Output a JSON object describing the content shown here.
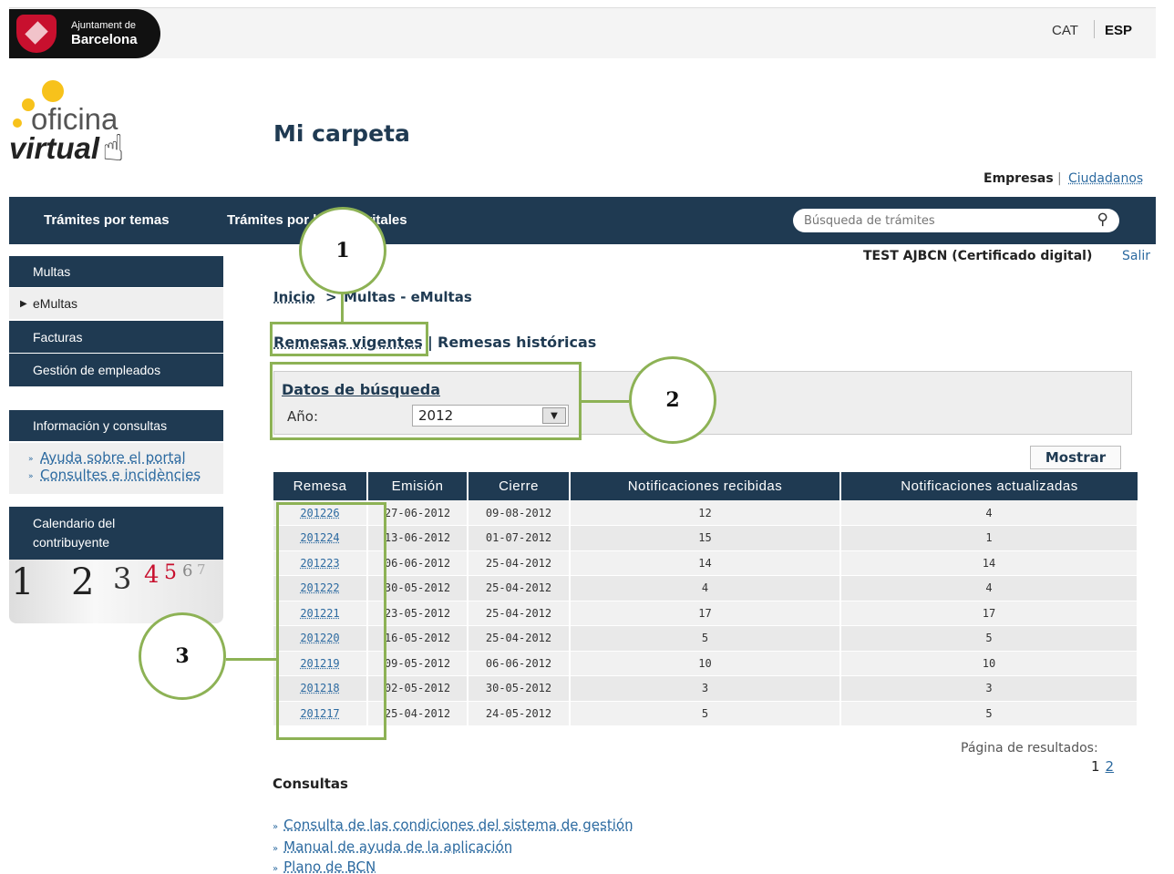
{
  "header": {
    "logo_line1": "Ajuntament de",
    "logo_line2": "Barcelona",
    "lang_cat": "CAT",
    "lang_esp": "ESP"
  },
  "brand": {
    "line1": "oficina",
    "line2": "virtual",
    "dot_color": "#f7c21b"
  },
  "page_title": "Mi carpeta",
  "audience": {
    "empresas": "Empresas",
    "sep": "|",
    "ciudadanos": "Ciudadanos"
  },
  "nav": {
    "items": [
      "Trámites por temas",
      "Trámites por hechos vitales"
    ],
    "search_placeholder": "Búsqueda de trámites",
    "search_icon": "magnifier-icon"
  },
  "user": {
    "name": "TEST AJBCN (Certificado digital)",
    "logout": "Salir"
  },
  "sidebar": {
    "items": [
      "Multas",
      "eMultas",
      "Facturas",
      "Gestión de empleados"
    ],
    "info_title": "Información y consultas",
    "info_links": [
      "Ayuda sobre el portal",
      "Consultes e incidències"
    ],
    "calendar_title_1": "Calendario del",
    "calendar_title_2": "contribuyente",
    "calendar_digits": [
      "1",
      "2",
      "3",
      "4",
      "5",
      "6",
      "7"
    ]
  },
  "breadcrumb": {
    "home": "Inicio",
    "sep": ">",
    "current": "Multas - eMultas"
  },
  "tabs": {
    "vigentes": "Remesas vigentes",
    "sep": "|",
    "historicas": "Remesas históricas"
  },
  "filter": {
    "title": "Datos de búsqueda",
    "year_label": "Año:",
    "year_value": "2012"
  },
  "show_button": "Mostrar",
  "table": {
    "headers": [
      "Remesa",
      "Emisión",
      "Cierre",
      "Notificaciones recibidas",
      "Notificaciones actualizadas"
    ],
    "rows": [
      [
        "201226",
        "27-06-2012",
        "09-08-2012",
        "12",
        "4"
      ],
      [
        "201224",
        "13-06-2012",
        "01-07-2012",
        "15",
        "1"
      ],
      [
        "201223",
        "06-06-2012",
        "25-04-2012",
        "14",
        "14"
      ],
      [
        "201222",
        "30-05-2012",
        "25-04-2012",
        "4",
        "4"
      ],
      [
        "201221",
        "23-05-2012",
        "25-04-2012",
        "17",
        "17"
      ],
      [
        "201220",
        "16-05-2012",
        "25-04-2012",
        "5",
        "5"
      ],
      [
        "201219",
        "09-05-2012",
        "06-06-2012",
        "10",
        "10"
      ],
      [
        "201218",
        "02-05-2012",
        "30-05-2012",
        "3",
        "3"
      ],
      [
        "201217",
        "25-04-2012",
        "24-05-2012",
        "5",
        "5"
      ]
    ]
  },
  "pagination": {
    "label": "Página de resultados:",
    "page1": "1",
    "page2": "2"
  },
  "consultas": {
    "title": "Consultas",
    "links": [
      "Consulta de las condiciones del sistema de gestión",
      "Manual de ayuda de la aplicación",
      "Plano de BCN"
    ]
  },
  "annotations": {
    "n1": "1",
    "n2": "2",
    "n3": "3",
    "color": "#8db255"
  },
  "colors": {
    "navy": "#1f3a52",
    "link": "#2c6aa0",
    "brand_red": "#c8102e"
  }
}
